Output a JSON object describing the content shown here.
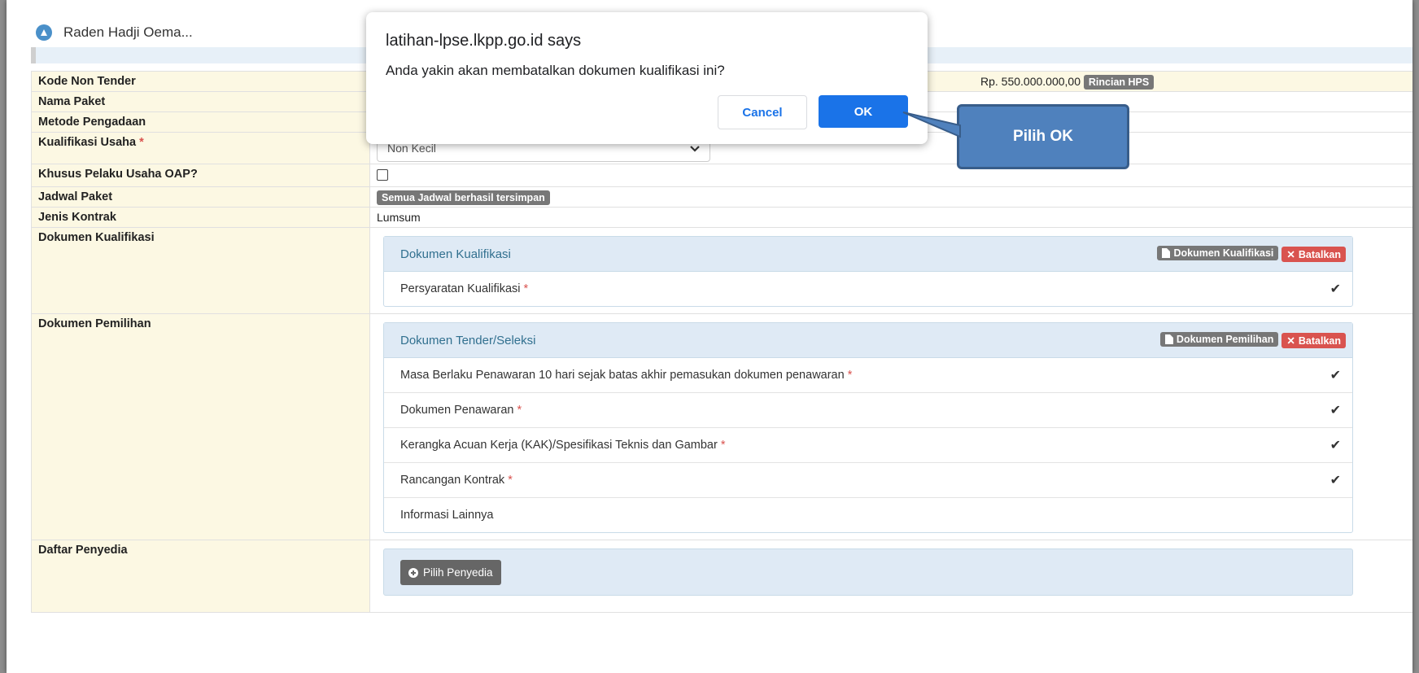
{
  "app": {
    "title": "Raden Hadji Oema..."
  },
  "dialog": {
    "origin": "latihan-lpse.lkpp.go.id says",
    "message": "Anda yakin akan membatalkan dokumen kualifikasi ini?",
    "cancel_label": "Cancel",
    "ok_label": "OK"
  },
  "callout": {
    "text": "Pilih OK"
  },
  "form": {
    "kode_non_tender": {
      "label": "Kode Non Tender",
      "hps_value": "Rp. 550.000.000,00",
      "hps_button": "Rincian HPS"
    },
    "nama_paket": {
      "label": "Nama Paket"
    },
    "metode_pengadaan": {
      "label": "Metode Pengadaan"
    },
    "kualifikasi_usaha": {
      "label": "Kualifikasi Usaha",
      "required_mark": "*",
      "selected": "Non Kecil"
    },
    "khusus_oap": {
      "label": "Khusus Pelaku Usaha OAP?"
    },
    "jadwal_paket": {
      "label": "Jadwal Paket",
      "badge": "Semua Jadwal berhasil tersimpan"
    },
    "jenis_kontrak": {
      "label": "Jenis Kontrak",
      "value": "Lumsum"
    },
    "dokumen_kualifikasi": {
      "label": "Dokumen Kualifikasi",
      "panel_title": "Dokumen Kualifikasi",
      "doc_button": "Dokumen Kualifikasi",
      "cancel_button": "Batalkan",
      "items": [
        {
          "text": "Persyaratan Kualifikasi",
          "required": "*",
          "checked": true
        }
      ]
    },
    "dokumen_pemilihan": {
      "label": "Dokumen Pemilihan",
      "panel_title": "Dokumen Tender/Seleksi",
      "doc_button": "Dokumen Pemilihan",
      "cancel_button": "Batalkan",
      "items": [
        {
          "text": "Masa Berlaku Penawaran 10 hari sejak batas akhir pemasukan dokumen penawaran",
          "required": "*",
          "checked": true
        },
        {
          "text": "Dokumen Penawaran",
          "required": "*",
          "checked": true
        },
        {
          "text": "Kerangka Acuan Kerja (KAK)/Spesifikasi Teknis dan Gambar",
          "required": "*",
          "checked": true
        },
        {
          "text": "Rancangan Kontrak",
          "required": "*",
          "checked": true
        },
        {
          "text": "Informasi Lainnya",
          "required": "",
          "checked": false
        }
      ]
    },
    "daftar_penyedia": {
      "label": "Daftar Penyedia",
      "button": "Pilih Penyedia"
    }
  },
  "colors": {
    "accent": "#1a73e8",
    "danger": "#d9534f",
    "label_bg": "#fcf8e3",
    "panel_head": "#dfeaf5",
    "callout": "#4f81bd"
  }
}
